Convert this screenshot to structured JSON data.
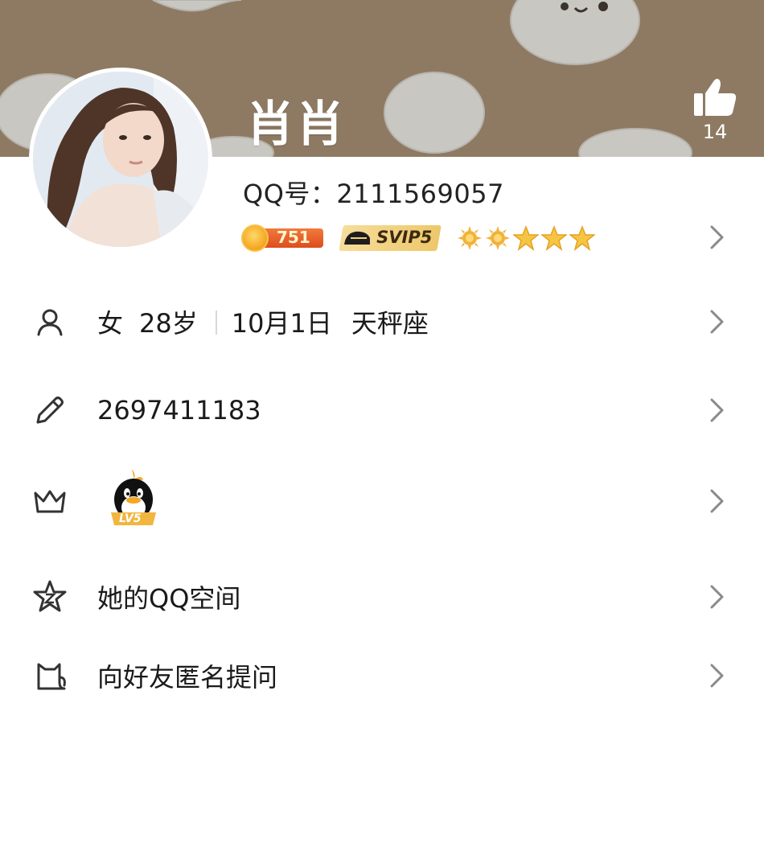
{
  "profile": {
    "nickname": "肖肖",
    "qq_line": "QQ号：2111569057",
    "likes": "14"
  },
  "badges": {
    "coin": "751",
    "svip": "SVIP5",
    "level_icons": [
      "sun-icon",
      "sun-icon",
      "star-icon",
      "star-icon",
      "star-icon"
    ]
  },
  "info": {
    "gender": "女",
    "age": "28岁",
    "birthday": "10月1日",
    "zodiac": "天秤座"
  },
  "signature_row": {
    "text": "2697411183"
  },
  "vip_row": {
    "badge_text": "LV5"
  },
  "qzone_row": {
    "label": "她的QQ空间"
  },
  "ask_row": {
    "label": "向好友匿名提问"
  },
  "colors": {
    "cover": "#8e7a63",
    "text": "#1a1a1a",
    "chevron": "#8a8a8a"
  }
}
